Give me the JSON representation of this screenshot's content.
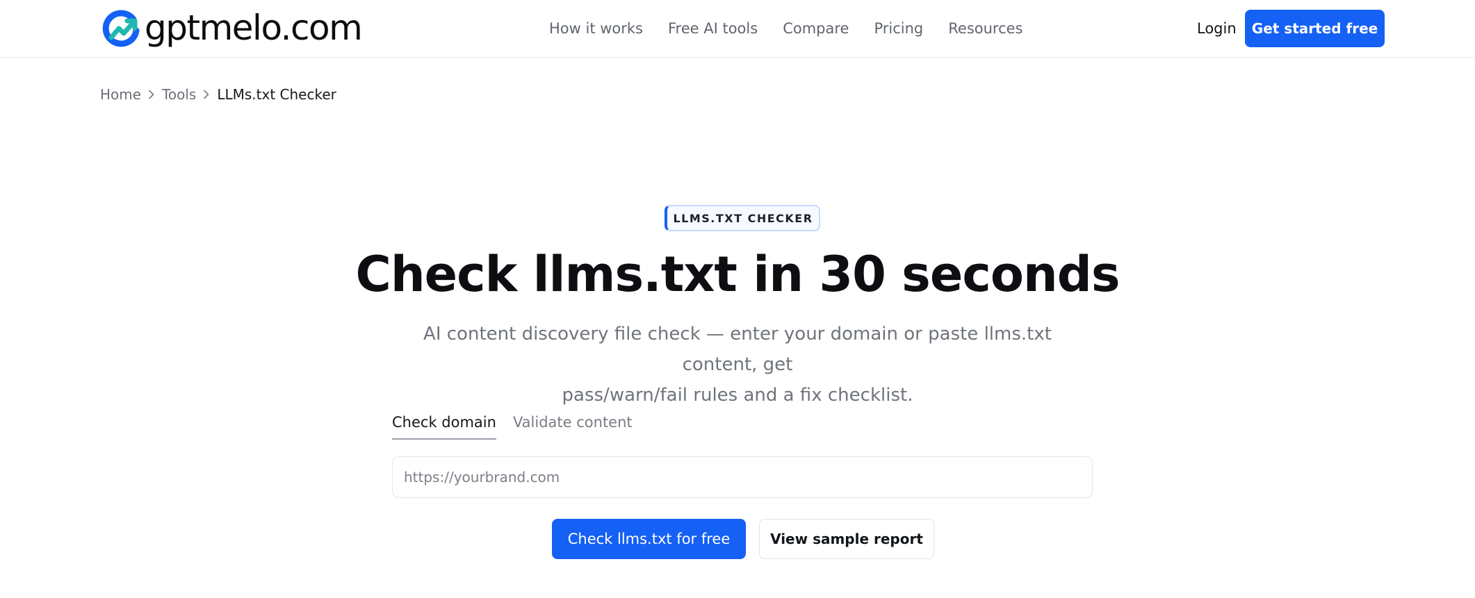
{
  "brand": {
    "name": "gptmelo.com",
    "logo_icon": "logo-g-arrow-icon",
    "accent_color": "#1560f5",
    "logo_teal": "#1fb8b0"
  },
  "nav": {
    "links": [
      "How it works",
      "Free AI tools",
      "Compare",
      "Pricing",
      "Resources"
    ],
    "login": "Login",
    "cta": "Get started free"
  },
  "breadcrumb": {
    "items": [
      "Home",
      "Tools",
      "LLMs.txt Checker"
    ],
    "separator_icon": "chevron-right-icon"
  },
  "hero": {
    "badge": "LLMS.TXT CHECKER",
    "title": "Check llms.txt in 30 seconds",
    "subtitle_line1": "AI content discovery file check — enter your domain or paste llms.txt content, get",
    "subtitle_line2": "pass/warn/fail rules and a fix checklist."
  },
  "tabs": [
    {
      "label": "Check domain",
      "active": true
    },
    {
      "label": "Validate content",
      "active": false
    }
  ],
  "form": {
    "url_placeholder": "https://yourbrand.com",
    "url_value": "",
    "primary_button": "Check llms.txt for free",
    "secondary_button": "View sample report"
  }
}
